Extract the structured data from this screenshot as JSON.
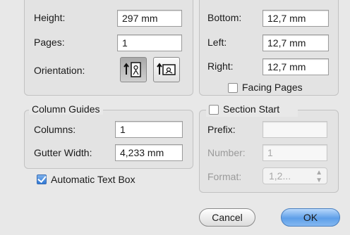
{
  "page": {
    "height_label": "Height:",
    "height_value": "297 mm",
    "pages_label": "Pages:",
    "pages_value": "1",
    "orientation_label": "Orientation:"
  },
  "margins": {
    "bottom_label": "Bottom:",
    "bottom_value": "12,7 mm",
    "left_label": "Left:",
    "left_value": "12,7 mm",
    "right_label": "Right:",
    "right_value": "12,7 mm",
    "facing_pages_label": "Facing Pages",
    "facing_pages_checked": false
  },
  "column_guides": {
    "title": "Column Guides",
    "columns_label": "Columns:",
    "columns_value": "1",
    "gutter_label": "Gutter Width:",
    "gutter_value": "4,233 mm"
  },
  "auto_text_box": {
    "label": "Automatic Text Box",
    "checked": true
  },
  "section_start": {
    "title": "Section Start",
    "checked": false,
    "prefix_label": "Prefix:",
    "prefix_value": "",
    "number_label": "Number:",
    "number_value": "1",
    "format_label": "Format:",
    "format_value": "1,2..."
  },
  "buttons": {
    "cancel": "Cancel",
    "ok": "OK"
  },
  "colors": {
    "ok_button": "#5e9fe9",
    "checkbox_checked": "#2f78d4"
  }
}
